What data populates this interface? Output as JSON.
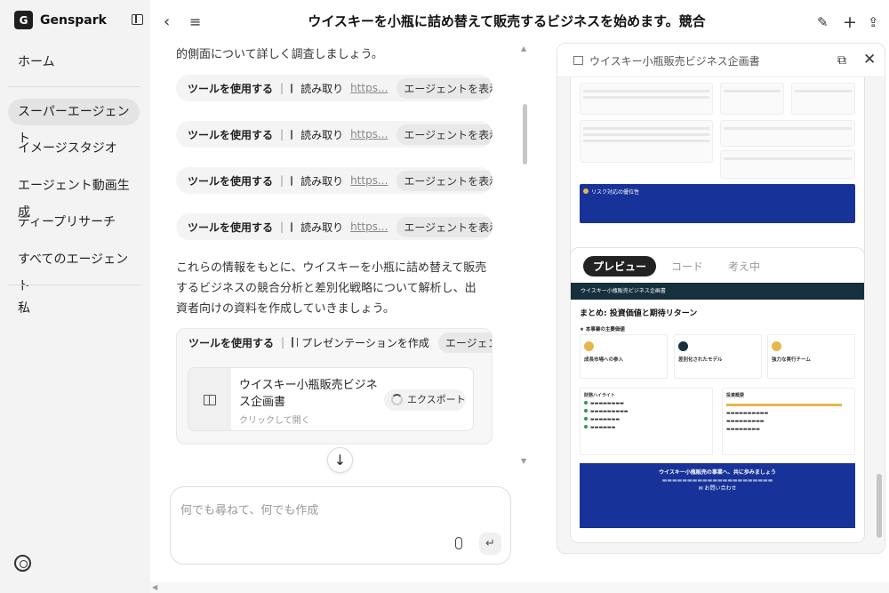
{
  "sidebar": {
    "brand": "Genspark",
    "logo_glyph": "G",
    "items": [
      {
        "label": "ホーム"
      },
      {
        "label": "スーパーエージェント"
      },
      {
        "label": "イメージスタジオ"
      },
      {
        "label": "エージェント動画生成"
      },
      {
        "label": "ディープリサーチ"
      },
      {
        "label": "すべてのエージェント"
      },
      {
        "label": "私"
      }
    ]
  },
  "header": {
    "title": "ウイスキーを小瓶に詰め替えて販売するビジネスを始めます。競合"
  },
  "chat": {
    "intro_fragment": "的側面について詳しく調査しましょう。",
    "tool_calls": [
      {
        "prefix": "ツールを使用する",
        "action": "読み取り",
        "link": "https...",
        "agent_btn": "エージェントを表示"
      },
      {
        "prefix": "ツールを使用する",
        "action": "読み取り",
        "link": "https...",
        "agent_btn": "エージェントを表示"
      },
      {
        "prefix": "ツールを使用する",
        "action": "読み取り",
        "link": "https...",
        "agent_btn": "エージェントを表示"
      },
      {
        "prefix": "ツールを使用する",
        "action": "読み取り",
        "link": "https...",
        "agent_btn": "エージェントを表示"
      }
    ],
    "summary_paragraph": "これらの情報をもとに、ウイスキーを小瓶に詰め替えて販売するビジネスの競合分析と差別化戦略について解析し、出資者向けの資料を作成していきましょう。",
    "presentation_tool": {
      "prefix": "ツールを使用する",
      "action": "プレゼンテーションを作成",
      "agent_btn": "エージェントを表示",
      "file_title": "ウイスキー小瓶販売ビジネス企画書",
      "file_sub": "クリックして開く",
      "export_label": "エクスポート"
    }
  },
  "input": {
    "placeholder": "何でも尋ねて、何でも作成"
  },
  "panel": {
    "title": "ウイスキー小瓶販売ビジネス企画書",
    "tabs": [
      "プレビュー",
      "コード",
      "考え中"
    ],
    "active_tab": 0,
    "slide": {
      "header_bar": "ウイスキー小瓶販売ビジネス企画書",
      "heading": "まとめ: 投資価値と期待リターン",
      "section_label": "★ 本事業の主要価値",
      "value_cards": [
        "成長市場への参入",
        "差別化されたモデル",
        "強力な実行チーム"
      ],
      "left_box_title": "財務ハイライト",
      "right_box_title": "投資概要",
      "cta_title": "ウイスキー小瓶販売の事業へ、共に歩みましょう",
      "cta_link": "お問い合わせ"
    },
    "top_slide": {
      "banner_title": "リスク対応の優位性"
    }
  },
  "colors": {
    "sidebar_bg": "#f3f3f3",
    "slide_header": "#16303e",
    "slide_blue": "#17339a",
    "accent_gold": "#e6b64a"
  }
}
